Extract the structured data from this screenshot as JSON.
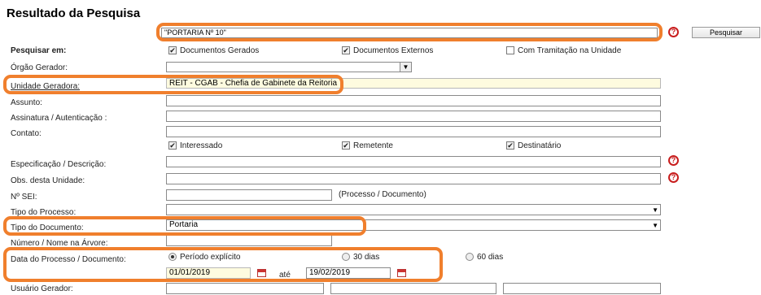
{
  "page": {
    "title": "Resultado da Pesquisa"
  },
  "search": {
    "query": "\"PORTARIA Nº 10\"",
    "button_label": "Pesquisar"
  },
  "search_in": {
    "label": "Pesquisar em:",
    "options": [
      {
        "label": "Documentos Gerados",
        "checked": true
      },
      {
        "label": "Documentos Externos",
        "checked": true
      },
      {
        "label": "Com Tramitação na Unidade",
        "checked": false
      }
    ]
  },
  "fields": {
    "orgao_gerador": {
      "label": "Órgão Gerador:",
      "value": ""
    },
    "unidade_geradora": {
      "label": "Unidade Geradora:",
      "value": "REIT - CGAB - Chefia de Gabinete da Reitoria"
    },
    "assunto": {
      "label": "Assunto:"
    },
    "assinatura": {
      "label": "Assinatura / Autenticação :"
    },
    "contato": {
      "label": "Contato:"
    },
    "especificacao": {
      "label": "Especificação / Descrição:"
    },
    "obs_unidade": {
      "label": "Obs. desta Unidade:"
    },
    "num_sei": {
      "label": "Nº SEI:",
      "hint": "(Processo / Documento)"
    },
    "tipo_processo": {
      "label": "Tipo do Processo:",
      "value": ""
    },
    "tipo_documento": {
      "label": "Tipo do Documento:",
      "value": "Portaria"
    },
    "numero_nome": {
      "label": "Número / Nome na Árvore:"
    },
    "data": {
      "label": "Data do Processo / Documento:",
      "from": "01/01/2019",
      "to_label": "até",
      "to": "19/02/2019"
    },
    "usuario_gerador": {
      "label": "Usuário Gerador:"
    }
  },
  "contact_roles": [
    {
      "label": "Interessado",
      "checked": true
    },
    {
      "label": "Remetente",
      "checked": true
    },
    {
      "label": "Destinatário",
      "checked": true
    }
  ],
  "period_options": [
    {
      "label": "Período explícito",
      "selected": true
    },
    {
      "label": "30 dias",
      "selected": false
    },
    {
      "label": "60 dias",
      "selected": false
    }
  ],
  "icons": {
    "help": "?",
    "check": "✔",
    "dropdown": "▼"
  },
  "colors": {
    "highlight": "#f07f2d",
    "help": "#c81d1d",
    "autocomplete_bg": "#fefbdf"
  }
}
